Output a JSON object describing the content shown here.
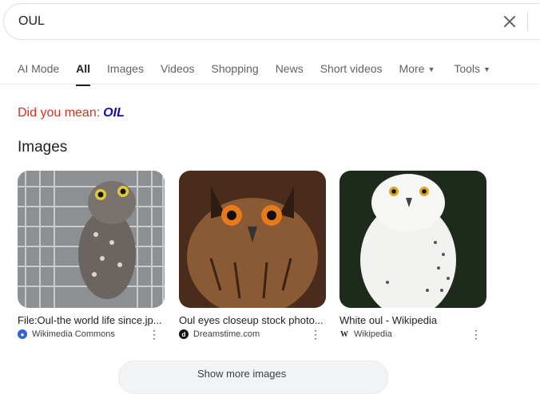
{
  "search": {
    "query": "OUL"
  },
  "tabs": [
    {
      "label": "AI Mode"
    },
    {
      "label": "All"
    },
    {
      "label": "Images"
    },
    {
      "label": "Videos"
    },
    {
      "label": "Shopping"
    },
    {
      "label": "News"
    },
    {
      "label": "Short videos"
    },
    {
      "label": "More"
    },
    {
      "label": "Tools"
    }
  ],
  "did_you_mean": {
    "prefix": "Did you mean:",
    "suggestion": "OIL"
  },
  "images_section": {
    "heading": "Images",
    "items": [
      {
        "caption": "File:Oul-the world life since.jp...",
        "source": "Wikimedia Commons",
        "favicon": "wikimedia-icon",
        "favicon_color": "#3366cc"
      },
      {
        "caption": "Oul eyes closeup stock photo...",
        "source": "Dreamstime.com",
        "favicon": "dreamstime-icon",
        "favicon_color": "#111111"
      },
      {
        "caption": "White oul - Wikipedia",
        "source": "Wikipedia",
        "favicon": "wikipedia-icon",
        "favicon_color": "#ffffff"
      }
    ]
  },
  "bottom": {
    "label": "Show more images"
  },
  "colors": {
    "did_you_mean": "#d93025",
    "suggestion": "#1a0dab"
  }
}
